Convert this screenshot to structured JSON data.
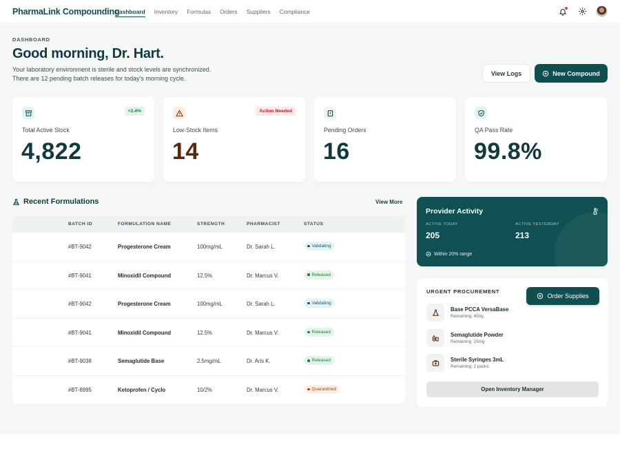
{
  "brand": "PharmaLink Compounding",
  "nav": [
    "Dashboard",
    "Inventory",
    "Formulas",
    "Orders",
    "Suppliers",
    "Compliance"
  ],
  "header": {
    "eyebrow": "DASHBOARD",
    "greeting": "Good morning, Dr. Hart.",
    "subtitle_line1": "Your laboratory environment is sterile and stock levels are synchronized.",
    "subtitle_line2": "There are 12 pending batch releases for today's morning cycle.",
    "view_logs": "View Logs",
    "new_compound": "New Compound"
  },
  "stats": [
    {
      "icon": "archive-icon",
      "label": "Total Active Stock",
      "value": "4,822",
      "badge": "+2.4%"
    },
    {
      "icon": "warning-icon",
      "label": "Low-Stock Items",
      "value": "14",
      "badge": "Action Needed"
    },
    {
      "icon": "pending-clipboard-icon",
      "label": "Pending Orders",
      "value": "16",
      "badge": ""
    },
    {
      "icon": "shield-check-icon",
      "label": "QA Pass Rate",
      "value": "99.8%",
      "badge": ""
    }
  ],
  "formulations": {
    "title": "Recent Formulations",
    "view_more": "View More",
    "columns": [
      "BATCH ID",
      "FORMULATION NAME",
      "STRENGTH",
      "PHARMACIST",
      "STATUS"
    ],
    "rows": [
      {
        "batch": "#BT-9042",
        "name": "Progesterone Cream",
        "strength": "100mg/mL",
        "pharmacist": "Dr. Sarah L.",
        "status": "Validating"
      },
      {
        "batch": "#BT-9041",
        "name": "Minoxidil Compound",
        "strength": "12.5%",
        "pharmacist": "Dr. Marcus V.",
        "status": "Released"
      },
      {
        "batch": "#BT-9042",
        "name": "Progesterone Cream",
        "strength": "100mg/mL",
        "pharmacist": "Dr. Sarah L.",
        "status": "Validating"
      },
      {
        "batch": "#BT-9041",
        "name": "Minoxidil Compound",
        "strength": "12.5%",
        "pharmacist": "Dr. Marcus V.",
        "status": "Released"
      },
      {
        "batch": "#BT-9038",
        "name": "Semaglutide Base",
        "strength": "2.5mg/mL",
        "pharmacist": "Dr. Aris K.",
        "status": "Released"
      },
      {
        "batch": "#BT-8995",
        "name": "Ketoprofen / Cyclo",
        "strength": "10/2%",
        "pharmacist": "Dr. Marcus V.",
        "status": "Quarantined"
      }
    ]
  },
  "provider": {
    "title": "Provider Activity",
    "active_today_label": "ACTIVE TODAY",
    "active_today": "205",
    "active_yesterday_label": "ACTIVE YESTERDAY",
    "active_yesterday": "213",
    "note": "Within 20% range"
  },
  "procurement": {
    "title": "URGENT PROCUREMENT",
    "order_button": "Order Supplies",
    "items": [
      {
        "icon": "flask-icon",
        "name": "Base PCCA VersaBase",
        "qty": "Remaining: 450g"
      },
      {
        "icon": "pills-icon",
        "name": "Semaglutide Powder",
        "qty": "Remaining: 15mg"
      },
      {
        "icon": "medical-kit-icon",
        "name": "Sterile Syringes 3mL",
        "qty": "Remaining: 2 packs"
      }
    ],
    "inventory_button": "Open Inventory Manager"
  },
  "colors": {
    "primary": "#0f4f50",
    "validating_bg": "#e4f3f5",
    "validating_fg": "#12575c",
    "released_bg": "#e2f5e8",
    "released_fg": "#1f7a44",
    "quarantined_bg": "#fbeee3",
    "quarantined_fg": "#9a4a16"
  }
}
